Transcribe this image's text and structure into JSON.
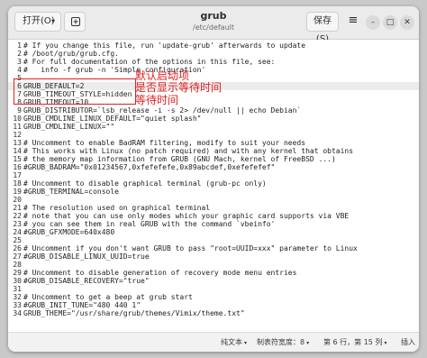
{
  "header": {
    "open_label": "打开(O)",
    "title": "grub",
    "subtitle": "/etc/default",
    "save_label": "保存(S)"
  },
  "editor": {
    "current_line": 6,
    "lines": [
      {
        "n": "1",
        "text": "# If you change this file, run 'update-grub' afterwards to update"
      },
      {
        "n": "2",
        "text": "# /boot/grub/grub.cfg."
      },
      {
        "n": "3",
        "text": "# For full documentation of the options in this file, see:"
      },
      {
        "n": "4",
        "text": "#   info -f grub -n 'Simple configuration'"
      },
      {
        "n": "5",
        "text": ""
      },
      {
        "n": "6",
        "text": "GRUB_DEFAULT=2"
      },
      {
        "n": "7",
        "text": "GRUB_TIMEOUT_STYLE=hidden"
      },
      {
        "n": "8",
        "text": "GRUB_TIMEOUT=10"
      },
      {
        "n": "9",
        "text": "GRUB_DISTRIBUTOR=`lsb_release -i -s 2> /dev/null || echo Debian`"
      },
      {
        "n": "10",
        "text": "GRUB_CMDLINE_LINUX_DEFAULT=\"quiet splash\""
      },
      {
        "n": "11",
        "text": "GRUB_CMDLINE_LINUX=\"\""
      },
      {
        "n": "12",
        "text": ""
      },
      {
        "n": "13",
        "text": "# Uncomment to enable BadRAM filtering, modify to suit your needs"
      },
      {
        "n": "14",
        "text": "# This works with Linux (no patch required) and with any kernel that obtains"
      },
      {
        "n": "15",
        "text": "# the memory map information from GRUB (GNU Mach, kernel of FreeBSD ...)"
      },
      {
        "n": "16",
        "text": "#GRUB_BADRAM=\"0x01234567,0xfefefefe,0x89abcdef,0xefefefef\""
      },
      {
        "n": "17",
        "text": ""
      },
      {
        "n": "18",
        "text": "# Uncomment to disable graphical terminal (grub-pc only)"
      },
      {
        "n": "19",
        "text": "#GRUB_TERMINAL=console"
      },
      {
        "n": "20",
        "text": ""
      },
      {
        "n": "21",
        "text": "# The resolution used on graphical terminal"
      },
      {
        "n": "22",
        "text": "# note that you can use only modes which your graphic card supports via VBE"
      },
      {
        "n": "23",
        "text": "# you can see them in real GRUB with the command `vbeinfo'"
      },
      {
        "n": "24",
        "text": "#GRUB_GFXMODE=640x480"
      },
      {
        "n": "25",
        "text": ""
      },
      {
        "n": "26",
        "text": "# Uncomment if you don't want GRUB to pass \"root=UUID=xxx\" parameter to Linux"
      },
      {
        "n": "27",
        "text": "#GRUB_DISABLE_LINUX_UUID=true"
      },
      {
        "n": "28",
        "text": ""
      },
      {
        "n": "29",
        "text": "# Uncomment to disable generation of recovery mode menu entries"
      },
      {
        "n": "30",
        "text": "#GRUB_DISABLE_RECOVERY=\"true\""
      },
      {
        "n": "31",
        "text": ""
      },
      {
        "n": "32",
        "text": "# Uncomment to get a beep at grub start"
      },
      {
        "n": "33",
        "text": "#GRUB_INIT_TUNE=\"480 440 1\""
      },
      {
        "n": "34",
        "text": "GRUB_THEME=\"/usr/share/grub/themes/Vimix/theme.txt\""
      }
    ]
  },
  "annotations": {
    "color": "#e02020",
    "line1": "默认启动项",
    "line2": "是否显示等待时间",
    "line3": "等待时间"
  },
  "status": {
    "format": "纯文本",
    "tab_width": "制表符宽度：8",
    "position": "第 6 行，第 15 列",
    "mode": "插入"
  }
}
